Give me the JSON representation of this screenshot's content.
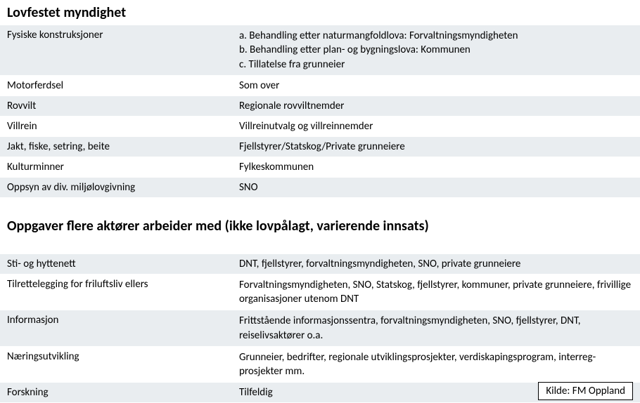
{
  "section1": {
    "title": "Lovfestet myndighet",
    "rows": [
      {
        "label": "Fysiske konstruksjoner",
        "value": "a. Behandling etter naturmangfoldlova: Forvaltningsmyndigheten\nb. Behandling etter plan- og bygningslova: Kommunen\nc. Tillatelse fra grunneier"
      },
      {
        "label": "Motorferdsel",
        "value": "Som over"
      },
      {
        "label": "Rovvilt",
        "value": "Regionale rovviltnemder"
      },
      {
        "label": "Villrein",
        "value": "Villreinutvalg og villreinnemder"
      },
      {
        "label": "Jakt, fiske, setring, beite",
        "value": "Fjellstyrer/Statskog/Private grunneiere"
      },
      {
        "label": "Kulturminner",
        "value": "Fylkeskommunen"
      },
      {
        "label": "Oppsyn av div. miljølovgivning",
        "value": "SNO"
      }
    ]
  },
  "section2": {
    "title": "Oppgaver flere aktører arbeider med (ikke lovpålagt, varierende innsats)",
    "rows": [
      {
        "label": "Sti- og hyttenett",
        "value": "DNT, fjellstyrer, forvaltningsmyndigheten, SNO, private grunneiere"
      },
      {
        "label": "Tilrettelegging for friluftsliv ellers",
        "value": "Forvaltningsmyndigheten, SNO, Statskog, fjellstyrer, kommuner, private grunneiere, frivillige organisasjoner utenom DNT"
      },
      {
        "label": "Informasjon",
        "value": "Frittstående informasjonssentra, forvaltningsmyndigheten, SNO, fjellstyrer, DNT, reiselivsaktører o.a."
      },
      {
        "label": "Næringsutvikling",
        "value": "Grunneier, bedrifter, regionale utviklingsprosjekter, verdiskapingsprogram, interreg-prosjekter mm."
      },
      {
        "label": "Forskning",
        "value": "Tilfeldig"
      }
    ]
  },
  "source": "Kilde: FM Oppland"
}
